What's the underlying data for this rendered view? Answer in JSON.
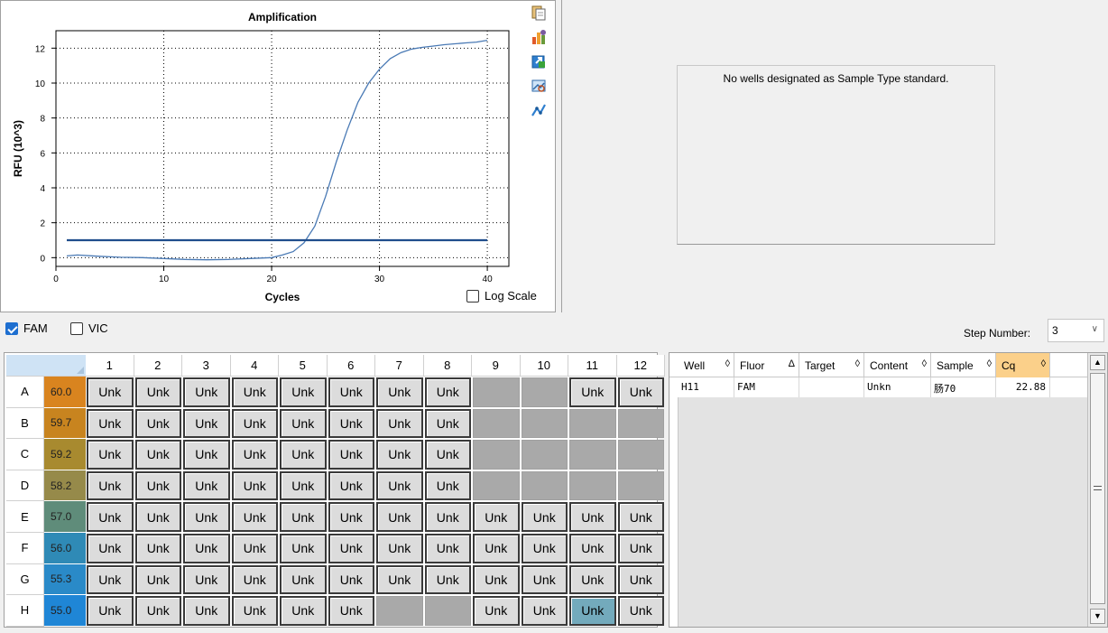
{
  "chart": {
    "title": "Amplification",
    "xlabel": "Cycles",
    "ylabel": "RFU (10^3)",
    "log_scale_label": "Log Scale",
    "log_scale_checked": false
  },
  "chart_data": {
    "type": "line",
    "title": "Amplification",
    "xlabel": "Cycles",
    "ylabel": "RFU (10^3)",
    "xlim": [
      0,
      42
    ],
    "ylim": [
      -0.5,
      13
    ],
    "xticks": [
      0,
      10,
      20,
      30,
      40
    ],
    "yticks": [
      0,
      2,
      4,
      6,
      8,
      10,
      12
    ],
    "grid": true,
    "series": [
      {
        "color": "#4a7ab5",
        "x": [
          1,
          2,
          4,
          6,
          8,
          10,
          12,
          14,
          16,
          18,
          20,
          21,
          22,
          23,
          24,
          25,
          26,
          27,
          28,
          29,
          30,
          31,
          32,
          33,
          34,
          35,
          36,
          37,
          38,
          39,
          40
        ],
        "y": [
          0.1,
          0.15,
          0.08,
          0.02,
          0.0,
          -0.05,
          -0.1,
          -0.12,
          -0.1,
          -0.05,
          0.0,
          0.15,
          0.35,
          0.85,
          1.8,
          3.5,
          5.5,
          7.3,
          8.9,
          10.0,
          10.8,
          11.4,
          11.75,
          11.95,
          12.05,
          12.12,
          12.2,
          12.25,
          12.3,
          12.35,
          12.45
        ]
      },
      {
        "color": "#1f4d8c",
        "x": [
          1,
          40
        ],
        "y": [
          1.0,
          1.0
        ]
      }
    ]
  },
  "toolbar": {
    "icons": [
      "copy-icon",
      "chart-options-icon",
      "export-icon",
      "zoom-image-icon",
      "line-style-icon"
    ]
  },
  "std_curve": {
    "message": "No wells designated as Sample Type standard."
  },
  "fluors": [
    {
      "label": "FAM",
      "checked": true
    },
    {
      "label": "VIC",
      "checked": false
    }
  ],
  "step": {
    "label": "Step Number:",
    "value": "3"
  },
  "plate": {
    "columns": [
      "1",
      "2",
      "3",
      "4",
      "5",
      "6",
      "7",
      "8",
      "9",
      "10",
      "11",
      "12"
    ],
    "rows": [
      {
        "label": "A",
        "temp": "60.0",
        "temp_color": "#d9841f",
        "wells": [
          "Unk",
          "Unk",
          "Unk",
          "Unk",
          "Unk",
          "Unk",
          "Unk",
          "Unk",
          "",
          "",
          "Unk",
          "Unk"
        ]
      },
      {
        "label": "B",
        "temp": "59.7",
        "temp_color": "#c8841f",
        "wells": [
          "Unk",
          "Unk",
          "Unk",
          "Unk",
          "Unk",
          "Unk",
          "Unk",
          "Unk",
          "",
          "",
          "",
          ""
        ]
      },
      {
        "label": "C",
        "temp": "59.2",
        "temp_color": "#a88a2f",
        "wells": [
          "Unk",
          "Unk",
          "Unk",
          "Unk",
          "Unk",
          "Unk",
          "Unk",
          "Unk",
          "",
          "",
          "",
          ""
        ]
      },
      {
        "label": "D",
        "temp": "58.2",
        "temp_color": "#968a4a",
        "wells": [
          "Unk",
          "Unk",
          "Unk",
          "Unk",
          "Unk",
          "Unk",
          "Unk",
          "Unk",
          "",
          "",
          "",
          ""
        ]
      },
      {
        "label": "E",
        "temp": "57.0",
        "temp_color": "#5f8c7a",
        "wells": [
          "Unk",
          "Unk",
          "Unk",
          "Unk",
          "Unk",
          "Unk",
          "Unk",
          "Unk",
          "Unk",
          "Unk",
          "Unk",
          "Unk"
        ]
      },
      {
        "label": "F",
        "temp": "56.0",
        "temp_color": "#2f8ab6",
        "wells": [
          "Unk",
          "Unk",
          "Unk",
          "Unk",
          "Unk",
          "Unk",
          "Unk",
          "Unk",
          "Unk",
          "Unk",
          "Unk",
          "Unk"
        ]
      },
      {
        "label": "G",
        "temp": "55.3",
        "temp_color": "#2a8ac8",
        "wells": [
          "Unk",
          "Unk",
          "Unk",
          "Unk",
          "Unk",
          "Unk",
          "Unk",
          "Unk",
          "Unk",
          "Unk",
          "Unk",
          "Unk"
        ]
      },
      {
        "label": "H",
        "temp": "55.0",
        "temp_color": "#1f86d6",
        "wells": [
          "Unk",
          "Unk",
          "Unk",
          "Unk",
          "Unk",
          "Unk",
          "",
          "",
          "Unk",
          "Unk",
          "Unk",
          "Unk"
        ]
      }
    ],
    "selected_well": "H11"
  },
  "results": {
    "columns": [
      {
        "label": "Well",
        "sort": "◊"
      },
      {
        "label": "Fluor",
        "sort": "Δ"
      },
      {
        "label": "Target",
        "sort": "◊"
      },
      {
        "label": "Content",
        "sort": "◊"
      },
      {
        "label": "Sample",
        "sort": "◊"
      },
      {
        "label": "Cq",
        "sort": "◊",
        "active": true
      }
    ],
    "rows": [
      {
        "Well": "H11",
        "Fluor": "FAM",
        "Target": "",
        "Content": "Unkn",
        "Sample": "肠70",
        "Cq": "22.88"
      }
    ]
  }
}
